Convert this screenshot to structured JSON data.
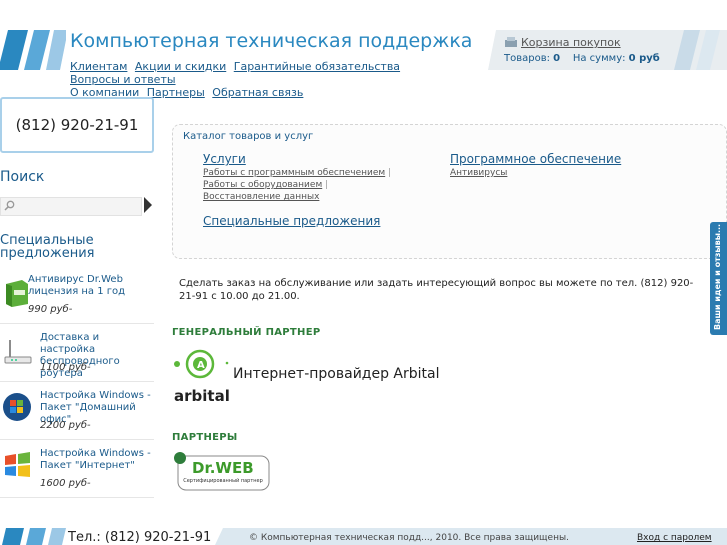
{
  "header": {
    "title": "Компьютерная техническая поддержка",
    "nav": [
      "Клиентам",
      "Акции и скидки",
      "Гарантийные обязательства",
      "Вопросы и ответы",
      "О компании",
      "Партнеры",
      "Обратная связь"
    ]
  },
  "cart": {
    "link": "Корзина покупок",
    "goods_label": "Товаров:",
    "goods_count": "0",
    "sum_label": "На сумму:",
    "sum_value": "0 руб"
  },
  "sidebar": {
    "phone": "(812) 920-21-91",
    "search_title": "Поиск",
    "search_value": "",
    "specials_title": "Специальные предложения",
    "specials": [
      {
        "title": "Антивирус Dr.Web лицензия на 1 год",
        "price": "990 руб-",
        "icon": "drweb-box-icon"
      },
      {
        "title": "Доставка и настройка беспроводного роутера",
        "price": "1100 руб-",
        "icon": "router-icon"
      },
      {
        "title": "Настройка Windows - Пакет \"Домашний офис\"",
        "price": "2200 руб-",
        "icon": "windows-orb-icon"
      },
      {
        "title": "Настройка Windows - Пакет \"Интернет\"",
        "price": "1600 руб-",
        "icon": "windows-flag-icon"
      }
    ]
  },
  "catalog": {
    "title": "Каталог товаров и услуг",
    "services": {
      "title": "Услуги",
      "items": [
        "Работы с программным обеспечением",
        "Работы с оборудованием",
        "Восстановление данных"
      ]
    },
    "software": {
      "title": "Программное обеспечение",
      "items": [
        "Антивирусы"
      ]
    },
    "specials": {
      "title": "Специальные предложения"
    }
  },
  "order_text": "Сделать заказ на обслуживание или задать интересующий вопрос вы можете по тел. (812) 920-21-91 с 10.00 до 21.00.",
  "general_partner": {
    "heading": "ГЕНЕРАЛЬНЫЙ ПАРТНЕР",
    "name": "Интернет-провайдер Arbital",
    "logo_text": "arbital"
  },
  "partners": {
    "heading": "ПАРТНЕРЫ",
    "drweb_logo": "Dr.WEB",
    "drweb_sub": "Сертифицированный партнер"
  },
  "feedback_tab": "Ваши идеи и отзывы...",
  "footer": {
    "phone": "Тел.: (812) 920-21-91",
    "copyright": "© Компьютерная техническая подд..., 2010. Все права защищены.",
    "login": "Вход с паролем"
  },
  "colors": {
    "accent": "#2a88c0",
    "link": "#1a5a8a",
    "partner_heading": "#2e7d3b",
    "feedback_tab": "#2b7bb0"
  }
}
